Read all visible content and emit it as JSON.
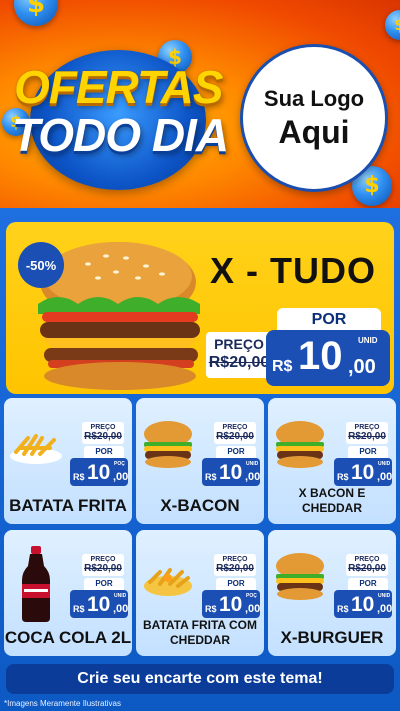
{
  "header": {
    "title_line1": "OFERTAS",
    "title_line2": "TODO DIA",
    "logo_line1": "Sua Logo",
    "logo_line2": "Aqui",
    "coin_symbol": "$"
  },
  "featured": {
    "name": "X - TUDO",
    "discount": "-50%",
    "old_label": "PREÇO",
    "old_price": "R$20,00",
    "new_label": "POR",
    "currency": "R$",
    "price_int": "10",
    "price_dec": ",00",
    "unit": "UNID"
  },
  "products": [
    {
      "name": "BATATA FRITA",
      "old_label": "PREÇO",
      "old_price": "R$20,00",
      "new_label": "POR",
      "currency": "R$",
      "price_int": "10",
      "price_dec": ",00",
      "unit": "POÇ",
      "icon": "fries-icon"
    },
    {
      "name": "X-BACON",
      "old_label": "PREÇO",
      "old_price": "R$20,00",
      "new_label": "POR",
      "currency": "R$",
      "price_int": "10",
      "price_dec": ",00",
      "unit": "UNID",
      "icon": "burger-icon"
    },
    {
      "name": "X BACON E CHEDDAR",
      "old_label": "PREÇO",
      "old_price": "R$20,00",
      "new_label": "POR",
      "currency": "R$",
      "price_int": "10",
      "price_dec": ",00",
      "unit": "UNID",
      "icon": "burger-icon"
    },
    {
      "name": "COCA COLA 2L",
      "old_label": "PREÇO",
      "old_price": "R$20,00",
      "new_label": "POR",
      "currency": "R$",
      "price_int": "10",
      "price_dec": ",00",
      "unit": "UNID",
      "icon": "soda-bottle-icon"
    },
    {
      "name": "BATATA FRITA COM CHEDDAR",
      "old_label": "PREÇO",
      "old_price": "R$20,00",
      "new_label": "POR",
      "currency": "R$",
      "price_int": "10",
      "price_dec": ",00",
      "unit": "POÇ",
      "icon": "fries-cheddar-icon"
    },
    {
      "name": "X-BURGUER",
      "old_label": "PREÇO",
      "old_price": "R$20,00",
      "new_label": "POR",
      "currency": "R$",
      "price_int": "10",
      "price_dec": ",00",
      "unit": "UNID",
      "icon": "burger-icon"
    }
  ],
  "footer": {
    "cta": "Crie seu encarte com este tema!",
    "disclaimer": "*Imagens Meramente Ilustrativas"
  },
  "colors": {
    "brand_blue": "#1b4fb4",
    "accent_yellow": "#ffc400",
    "header_orange": "#ff8a00"
  }
}
